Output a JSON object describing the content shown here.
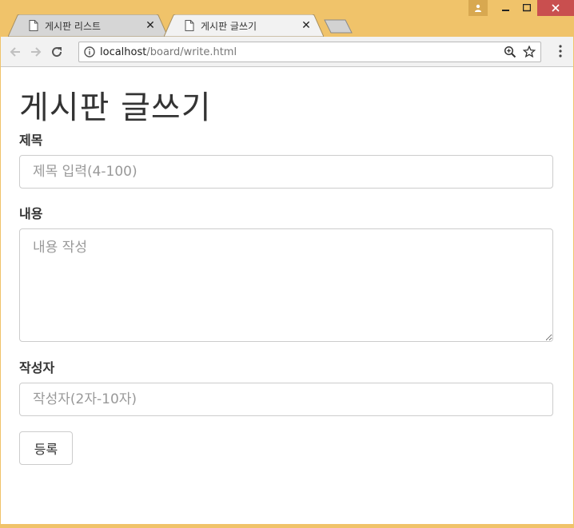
{
  "browser": {
    "tabs": [
      {
        "title": "게시판 리스트",
        "close": "✕"
      },
      {
        "title": "게시판 글쓰기",
        "close": "✕"
      }
    ],
    "url": {
      "host": "localhost",
      "path": "/board/write.html"
    }
  },
  "page": {
    "heading": "게시판 글쓰기",
    "title_label": "제목",
    "title_placeholder": "제목 입력(4-100)",
    "content_label": "내용",
    "content_placeholder": "내용 작성",
    "author_label": "작성자",
    "author_placeholder": "작성자(2자-10자)",
    "submit_label": "등록"
  },
  "colors": {
    "frame": "#f0c36a",
    "close_button": "#c94f4f"
  }
}
